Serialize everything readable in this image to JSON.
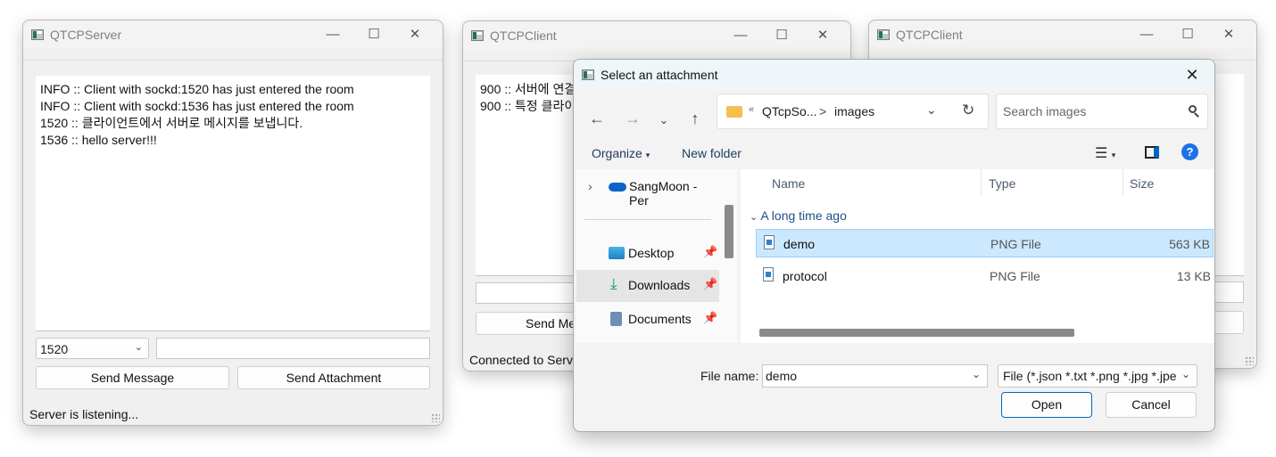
{
  "server": {
    "title": "QTCPServer",
    "log": [
      "INFO :: Client with sockd:1520 has just entered the room",
      "INFO :: Client with sockd:1536 has just entered the room",
      "1520 :: 클라이언트에서 서버로 메시지를 보냅니다.",
      "1536 :: hello server!!!"
    ],
    "client_select": "1520",
    "send_message_label": "Send Message",
    "send_attachment_label": "Send Attachment",
    "status": "Server is listening..."
  },
  "client1": {
    "title": "QTCPClient",
    "log": [
      "900 :: 서버에 연결",
      "900 :: 특정 클라이"
    ],
    "send_label": "Send Me",
    "status": "Connected to Serve"
  },
  "client2": {
    "title": "QTCPClient"
  },
  "dialog": {
    "title": "Select an attachment",
    "breadcrumb_prefix": "«",
    "breadcrumb_parent": "QTcpSo...",
    "breadcrumb_sep": ">",
    "breadcrumb_current": "images",
    "search_placeholder": "Search images",
    "organize_label": "Organize",
    "new_folder_label": "New folder",
    "nav": {
      "onedrive": "SangMoon - Per",
      "desktop": "Desktop",
      "downloads": "Downloads",
      "documents": "Documents"
    },
    "columns": {
      "name": "Name",
      "type": "Type",
      "size": "Size"
    },
    "group_label": "A long time ago",
    "files": [
      {
        "name": "demo",
        "type": "PNG File",
        "size": "563 KB"
      },
      {
        "name": "protocol",
        "type": "PNG File",
        "size": "13 KB"
      }
    ],
    "filename_label": "File name:",
    "filename_value": "demo",
    "filter_value": "File (*.json *.txt *.png *.jpg *.jpe",
    "open_label": "Open",
    "cancel_label": "Cancel"
  },
  "colors": {
    "selection": "#cce8ff",
    "accent": "#0067c0",
    "help": "#1a73e8"
  }
}
